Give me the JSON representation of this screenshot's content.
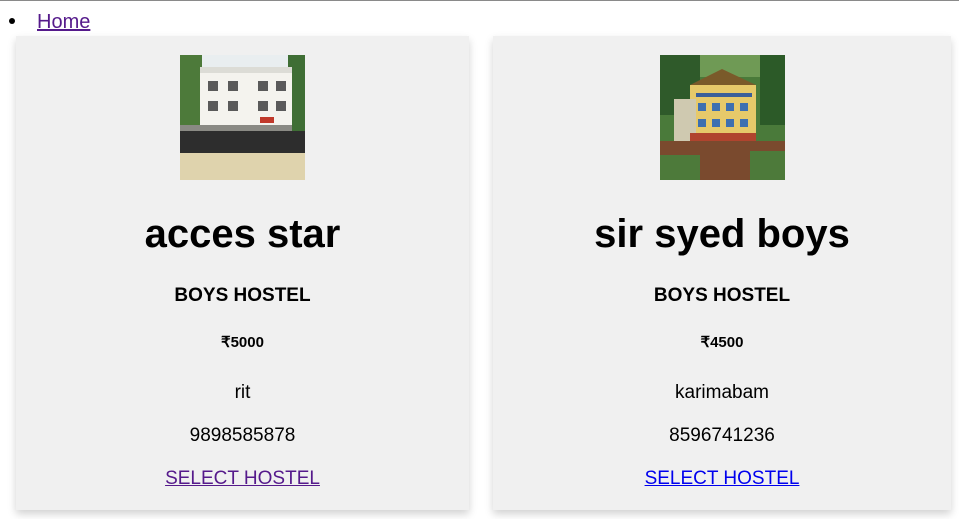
{
  "nav": {
    "home_label": "Home"
  },
  "hostels": [
    {
      "name": "acces star",
      "type": "BOYS HOSTEL",
      "price": "₹5000",
      "location": "rit",
      "phone": "9898585878",
      "select_label": "SELECT HOSTEL"
    },
    {
      "name": "sir syed boys",
      "type": "BOYS HOSTEL",
      "price": "₹4500",
      "location": "karimabam",
      "phone": "8596741236",
      "select_label": "SELECT HOSTEL"
    }
  ],
  "colors": {
    "visited_link": "#551a8b",
    "link": "#0000ee",
    "card_background": "#f0f0f0"
  }
}
